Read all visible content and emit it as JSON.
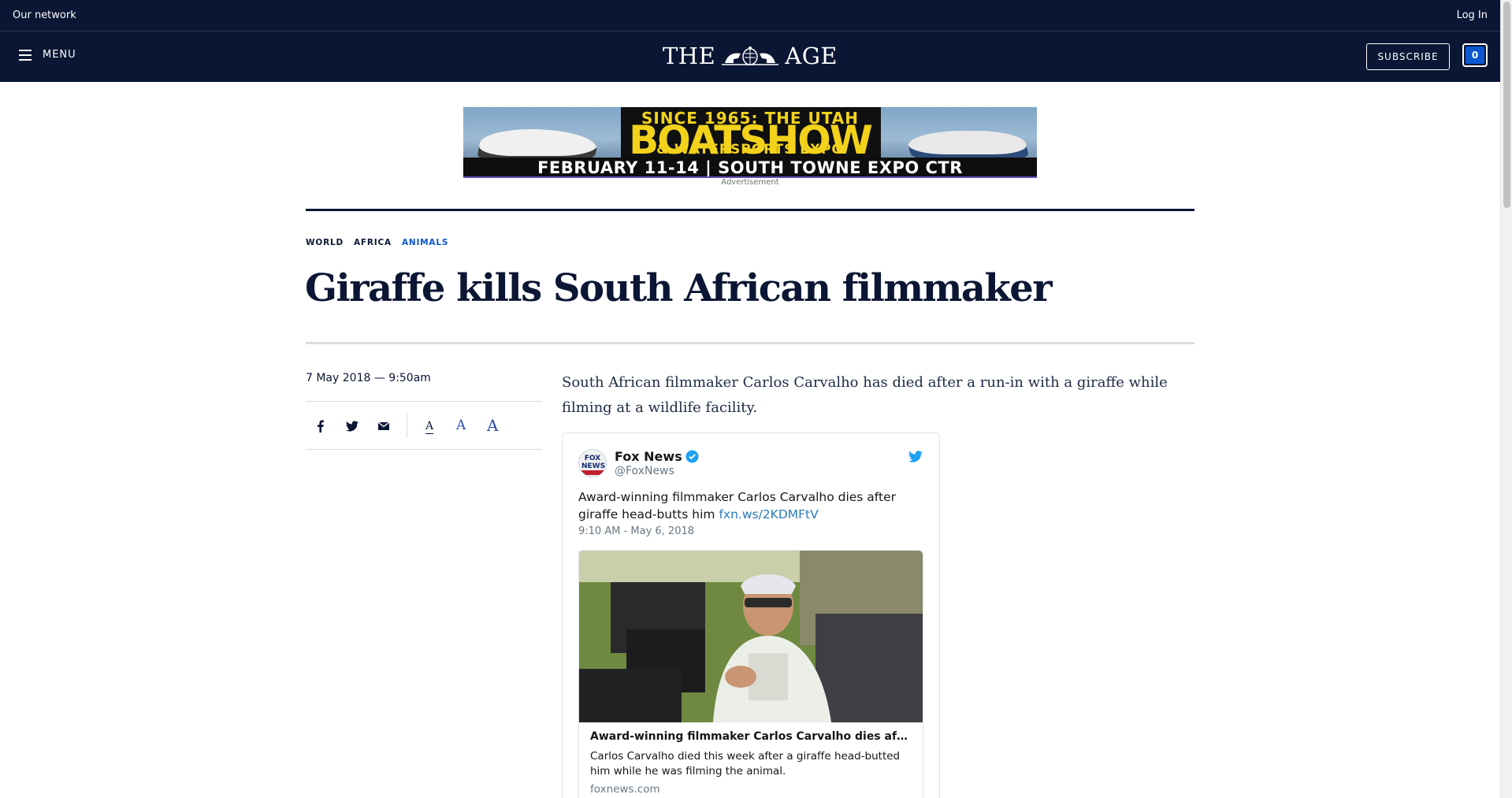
{
  "network_bar": {
    "network_label": "Our network",
    "login_label": "Log In"
  },
  "masthead": {
    "menu_label": "MENU",
    "logo_left": "THE",
    "logo_right": "AGE",
    "subscribe_label": "SUBSCRIBE",
    "cart_count": "0"
  },
  "ad": {
    "line1": "SINCE 1965: THE UTAH",
    "line2": "BOATSHOW",
    "line3": "& WATERSPORTS EXPO",
    "line4": "FEBRUARY 11-14  |  SOUTH TOWNE EXPO CTR",
    "label": "Advertisement"
  },
  "article": {
    "tags": [
      "WORLD",
      "AFRICA",
      "ANIMALS"
    ],
    "headline": "Giraffe kills South African filmmaker",
    "date": "7 May 2018 — 9:50am",
    "lede": "South African filmmaker Carlos Carvalho has died after a run-in with a giraffe while filming at a wildlife facility.",
    "font_size_glyph": "A"
  },
  "tweet": {
    "avatar_text": "FOX NEWS",
    "name": "Fox News",
    "handle": "@FoxNews",
    "text": "Award-winning filmmaker Carlos Carvalho dies after giraffe head-butts him",
    "link": "fxn.ws/2KDMFtV",
    "timestamp": "9:10 AM - May 6, 2018",
    "card": {
      "title": "Award-winning filmmaker Carlos Carvalho dies af…",
      "description": "Carlos Carvalho died this week after a giraffe head-butted him while he was filming the animal.",
      "domain": "foxnews.com"
    }
  },
  "colors": {
    "navy": "#0a1633",
    "link_blue": "#0b57d0",
    "twitter_blue": "#1da1f2"
  }
}
